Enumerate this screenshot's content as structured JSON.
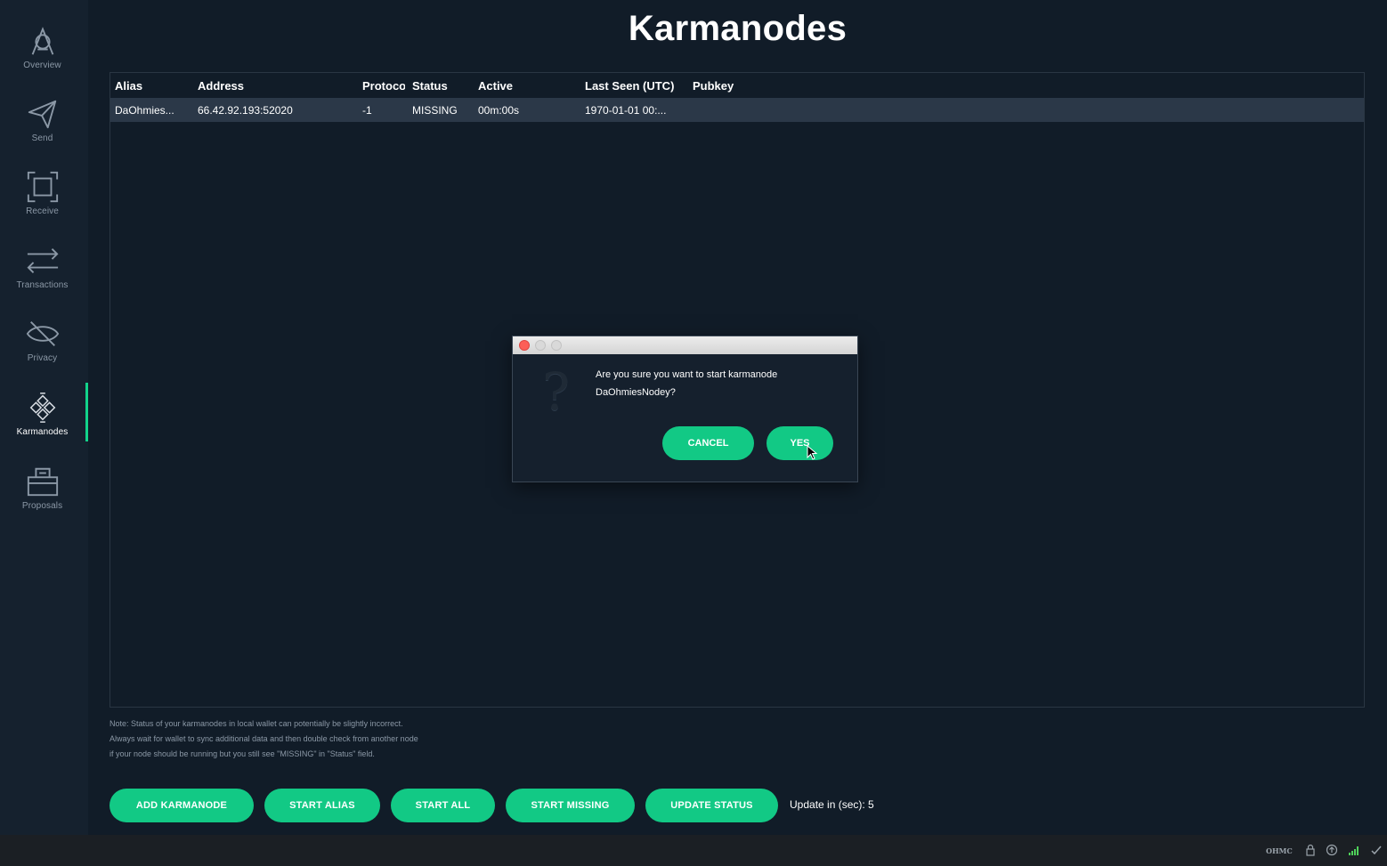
{
  "sidebar": {
    "items": [
      {
        "label": "Overview",
        "icon": "logo-icon"
      },
      {
        "label": "Send",
        "icon": "send-icon"
      },
      {
        "label": "Receive",
        "icon": "receive-icon"
      },
      {
        "label": "Transactions",
        "icon": "transactions-icon"
      },
      {
        "label": "Privacy",
        "icon": "eye-off-icon"
      },
      {
        "label": "Karmanodes",
        "icon": "karmanodes-icon",
        "active": true
      },
      {
        "label": "Proposals",
        "icon": "ballot-box-icon"
      }
    ]
  },
  "page": {
    "title": "Karmanodes"
  },
  "table": {
    "headers": {
      "alias": "Alias",
      "address": "Address",
      "protocol": "Protocol",
      "status": "Status",
      "active": "Active",
      "last_seen": "Last Seen (UTC)",
      "pubkey": "Pubkey"
    },
    "rows": [
      {
        "alias": "DaOhmies...",
        "address": "66.42.92.193:52020",
        "protocol": "-1",
        "status": "MISSING",
        "active": "00m:00s",
        "last_seen": "1970-01-01 00:...",
        "pubkey": ""
      }
    ]
  },
  "note": {
    "line1": "Note: Status of your karmanodes in local wallet can potentially be slightly incorrect.",
    "line2": "Always wait for wallet to sync additional data and then double check from another node",
    "line3": "if your node should be running but you still see \"MISSING\" in \"Status\" field."
  },
  "buttons": {
    "add": "ADD KARMANODE",
    "start_alias": "START ALIAS",
    "start_all": "START ALL",
    "start_missing": "START MISSING",
    "update_status": "UPDATE STATUS"
  },
  "update": {
    "label": "Update in (sec):",
    "value": "5"
  },
  "dialog": {
    "line1": "Are you sure you want to start karmanode",
    "line2": "DaOhmiesNodey?",
    "cancel": "CANCEL",
    "yes": "YES"
  },
  "statusbar": {
    "unit": "OHMC"
  },
  "colors": {
    "accent": "#12c985",
    "background": "#111c28",
    "sidebar": "#15212e",
    "selected_row": "#2b3848"
  }
}
